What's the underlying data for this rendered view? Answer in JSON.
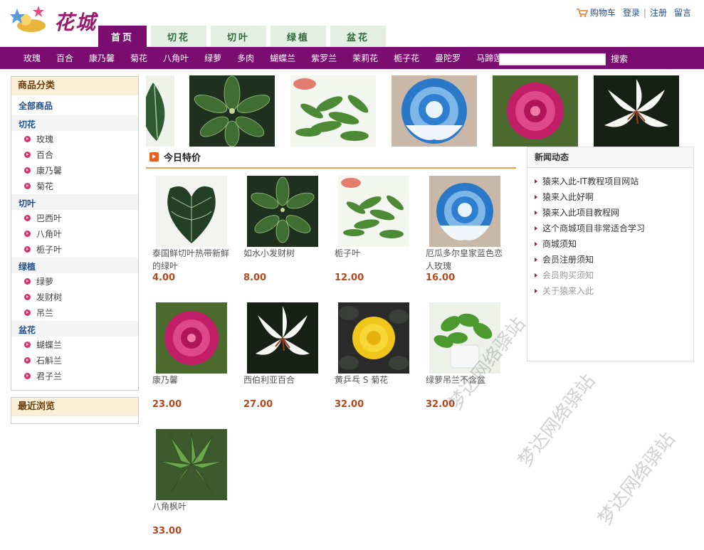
{
  "header": {
    "logo_text": "花城",
    "cart_label": "购物车",
    "login_label": "登录",
    "register_label": "注册",
    "message_label": "留言",
    "tabs": [
      {
        "label": "首页",
        "active": true
      },
      {
        "label": "切花",
        "active": false
      },
      {
        "label": "切叶",
        "active": false
      },
      {
        "label": "绿植",
        "active": false
      },
      {
        "label": "盆花",
        "active": false
      }
    ]
  },
  "categories": [
    "玫瑰",
    "百合",
    "康乃馨",
    "菊花",
    "八角叶",
    "绿萝",
    "多肉",
    "蝴蝶兰",
    "紫罗兰",
    "茉莉花",
    "栀子花",
    "曼陀罗",
    "马蹄莲"
  ],
  "search": {
    "value": "",
    "button_label": "搜索"
  },
  "sidebar": {
    "title": "商品分类",
    "all_label": "全部商品",
    "groups": [
      {
        "name": "切花",
        "items": [
          "玫瑰",
          "百合",
          "康乃馨",
          "菊花"
        ]
      },
      {
        "name": "切叶",
        "items": [
          "巴西叶",
          "八角叶",
          "栀子叶"
        ]
      },
      {
        "name": "绿植",
        "items": [
          "绿萝",
          "发财树",
          "吊兰"
        ]
      },
      {
        "name": "盆花",
        "items": [
          "蝴蝶兰",
          "石斛兰",
          "君子兰"
        ]
      }
    ],
    "recent_title": "最近浏览"
  },
  "banner": [
    "leaf-green",
    "schefflera",
    "gardenia-leaf",
    "blue-rose",
    "peony",
    "lily"
  ],
  "today": {
    "title": "今日特价",
    "products": [
      {
        "name": "泰国鲜切叶热带新鲜的绿叶",
        "price": "4.00",
        "image": "anthurium-leaf"
      },
      {
        "name": "如水小发财树",
        "price": "8.00",
        "image": "schefflera"
      },
      {
        "name": "栀子叶",
        "price": "12.00",
        "image": "gardenia-leaf"
      },
      {
        "name": "厄瓜多尔皇家蓝色恋人玫瑰",
        "price": "16.00",
        "image": "blue-rose"
      },
      {
        "name": "康乃馨",
        "price": "23.00",
        "image": "peony"
      },
      {
        "name": "西伯利亚百合",
        "price": "27.00",
        "image": "lily"
      },
      {
        "name": "黄乒乓 S 菊花",
        "price": "32.00",
        "image": "chrysanthemum"
      },
      {
        "name": "绿萝吊兰不含盆",
        "price": "32.00",
        "image": "pothos"
      },
      {
        "name": "八角枫叶",
        "price": "33.00",
        "image": "fatsia"
      }
    ]
  },
  "news": {
    "title": "新闻动态",
    "items": [
      {
        "text": "猿来入此-IT教程项目网站",
        "dim": false
      },
      {
        "text": "猿来入此好啊",
        "dim": false
      },
      {
        "text": "猿来入此项目教程网",
        "dim": false
      },
      {
        "text": "这个商城项目非常适合学习",
        "dim": false
      },
      {
        "text": "商城须知",
        "dim": false
      },
      {
        "text": "会员注册须知",
        "dim": false
      },
      {
        "text": "会员购买须知",
        "dim": true
      },
      {
        "text": "关于猿来入此",
        "dim": true
      }
    ]
  },
  "watermark": "梦达网络驿站",
  "colors": {
    "brand": "#7b0c70",
    "price": "#b5471d",
    "tab_bg": "#e2efe2",
    "accent_line": "#f0a050"
  }
}
